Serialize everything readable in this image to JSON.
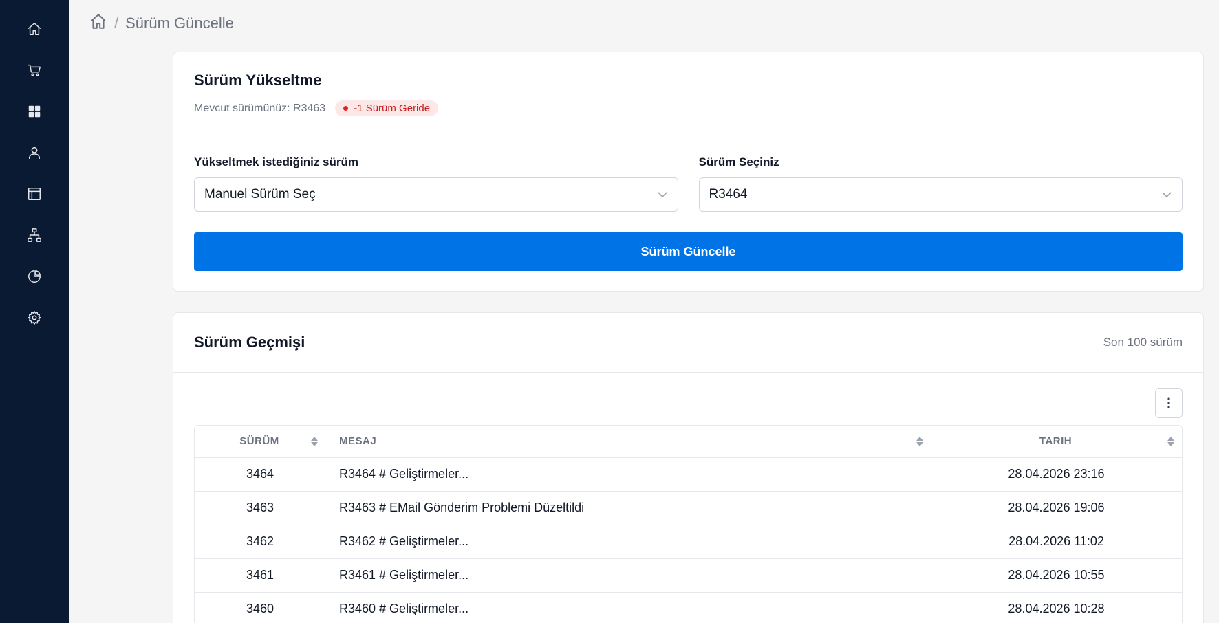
{
  "sidebar": {
    "items": [
      {
        "icon": "home-icon"
      },
      {
        "icon": "cart-icon"
      },
      {
        "icon": "grid-icon"
      },
      {
        "icon": "user-icon"
      },
      {
        "icon": "layout-icon"
      },
      {
        "icon": "sitemap-icon"
      },
      {
        "icon": "pie-chart-icon"
      },
      {
        "icon": "gear-icon"
      }
    ]
  },
  "breadcrumb": {
    "separator": "/",
    "current": "Sürüm Güncelle"
  },
  "upgrade": {
    "title": "Sürüm Yükseltme",
    "current_version_text": "Mevcut sürümünüz: R3463",
    "status_badge": "-1 Sürüm Geride",
    "target_label": "Yükseltmek istediğiniz sürüm",
    "target_value": "Manuel Sürüm Seç",
    "version_label": "Sürüm Seçiniz",
    "version_value": "R3464",
    "update_button": "Sürüm Güncelle"
  },
  "history": {
    "title": "Sürüm Geçmişi",
    "count_text": "Son 100 sürüm",
    "columns": [
      "SÜRÜM",
      "MESAJ",
      "TARIH"
    ],
    "rows": [
      {
        "version": "3464",
        "message": "R3464 # Geliştirmeler...",
        "date": "28.04.2026 23:16"
      },
      {
        "version": "3463",
        "message": "R3463 # EMail Gönderim Problemi Düzeltildi",
        "date": "28.04.2026 19:06"
      },
      {
        "version": "3462",
        "message": "R3462 # Geliştirmeler...",
        "date": "28.04.2026 11:02"
      },
      {
        "version": "3461",
        "message": "R3461 # Geliştirmeler...",
        "date": "28.04.2026 10:55"
      },
      {
        "version": "3460",
        "message": "R3460 # Geliştirmeler...",
        "date": "28.04.2026 10:28"
      }
    ]
  },
  "colors": {
    "sidebar_bg": "#0b1a33",
    "primary": "#0073e6",
    "badge_bg": "#fde8e8",
    "badge_text": "#c81e1e"
  }
}
